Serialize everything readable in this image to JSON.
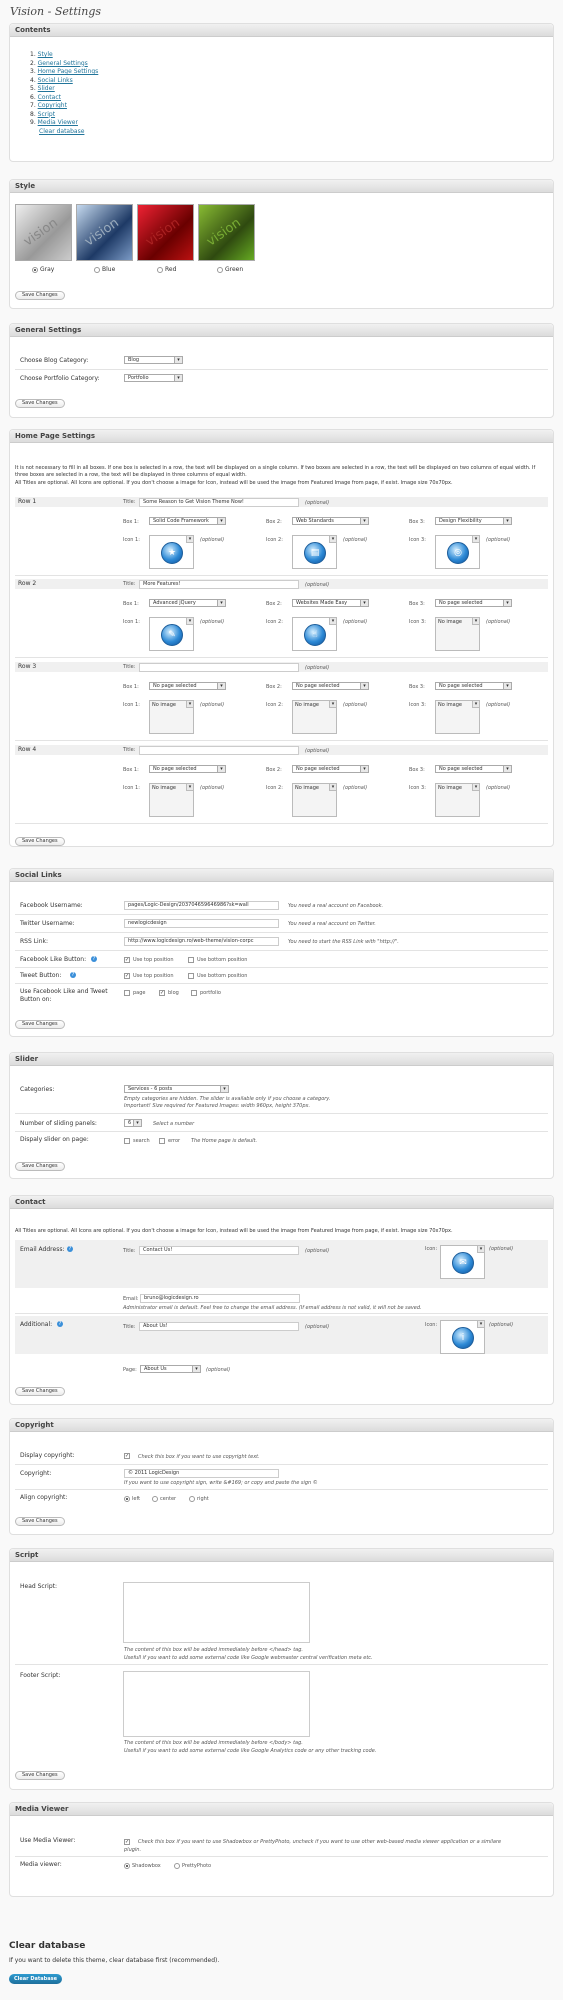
{
  "page_title": "Vision - Settings",
  "contents": {
    "heading": "Contents",
    "items": [
      "Style",
      "General Settings",
      "Home Page Settings",
      "Social Links",
      "Slider",
      "Contact",
      "Copyright",
      "Script",
      "Media Viewer"
    ],
    "clear_link": "Clear database"
  },
  "save_label": "Save Changes",
  "style": {
    "heading": "Style",
    "options": [
      {
        "label": "Gray",
        "selected": true
      },
      {
        "label": "Blue",
        "selected": false
      },
      {
        "label": "Red",
        "selected": false
      },
      {
        "label": "Green",
        "selected": false
      }
    ],
    "thumb_text": "vision"
  },
  "general": {
    "heading": "General Settings",
    "blog_label": "Choose Blog Category:",
    "blog_value": "Blog",
    "portfolio_label": "Choose Portfolio Category:",
    "portfolio_value": "Portfolio"
  },
  "home": {
    "heading": "Home Page Settings",
    "intro1": "It is not necessary to fill in all boxes. If one box is selected in a row, the text will be displayed on a single column. If two boxes are selected in a row, the text will be displayed on two columns of equal width. If three boxes are selected in a row, the text will be displayed in three columns of equal width.",
    "intro2": "All Titles are optional. All Icons are optional. If you don't choose a image for Icon, instead will be used the image from Featured Image from page, if exist. Image size 70x70px.",
    "title_label": "Title:",
    "optional": "(optional)",
    "box1": "Box 1:",
    "box2": "Box 2:",
    "box3": "Box 3:",
    "icon1": "Icon 1:",
    "icon2": "Icon 2:",
    "icon3": "Icon 3:",
    "no_image": "No image",
    "rows": [
      {
        "label": "Row 1",
        "title": "Some Reason to Get Vision Theme Now!",
        "boxes": [
          "Solid Code Framework",
          "Web Standards",
          "Design Flexibility"
        ],
        "icons": [
          true,
          true,
          true
        ]
      },
      {
        "label": "Row 2",
        "title": "More Features!",
        "boxes": [
          "Advanced jQuery",
          "Websites Made Easy",
          "No page selected"
        ],
        "icons": [
          true,
          true,
          false
        ]
      },
      {
        "label": "Row 3",
        "title": "",
        "boxes": [
          "No page selected",
          "No page selected",
          "No page selected"
        ],
        "icons": [
          false,
          false,
          false
        ]
      },
      {
        "label": "Row 4",
        "title": "",
        "boxes": [
          "No page selected",
          "No page selected",
          "No page selected"
        ],
        "icons": [
          false,
          false,
          false
        ]
      }
    ]
  },
  "social": {
    "heading": "Social Links",
    "fb_label": "Facebook Username:",
    "fb_value": "pages/Logic-Design/203704659646986?sk=wall",
    "fb_note": "You need a real account on Facebook.",
    "tw_label": "Twitter Username:",
    "tw_value": "newlogicdesign",
    "tw_note": "You need a real account on Twitter.",
    "rss_label": "RSS Link:",
    "rss_value": "http://www.logicdesign.ro/web-theme/vision-corpc",
    "rss_note": "You need to start the RSS Link with \"http://\".",
    "fblike_label": "Facebook Like Button:",
    "tweet_label": "Tweet Button:",
    "use_top": "Use top position",
    "use_bottom": "Use bottom position",
    "show_label1": "Use Facebook Like and Tweet",
    "show_label2": "Button on:",
    "page": "page",
    "blog": "blog",
    "portfolio": "portfolio"
  },
  "slider": {
    "heading": "Slider",
    "cat_label": "Categories:",
    "cat_value": "Services - 6 posts",
    "note1": "Empty categories are hidden. The slider is available only if you choose a category.",
    "note2": "Important! Size required for Featured Images: width 960px, height 370px.",
    "panels_label": "Number of sliding panels:",
    "panels_value": "6",
    "panels_note": "Select a number",
    "display_label": "Dispaly slider on page:",
    "search": "search",
    "error": "error",
    "display_note": "The Home page is default."
  },
  "contact": {
    "heading": "Contact",
    "intro": "All Titles are optional. All Icons are optional. If you don't choose a image for Icon, instead will be used the image from Featured Image from page, if exist. Image size 70x70px.",
    "email_label": "Email Address:",
    "title_label": "Title:",
    "title_value": "Contact Us!",
    "optional": "(optional)",
    "icon_label": "Icon:",
    "email_field_label": "Email:",
    "email_value": "bruno@logicdesign.ro",
    "email_note": "Administrator email is default. Feel free to change the email address. (If email address is not valid, it will not be saved.",
    "add_label": "Additional:",
    "add_title": "About Us!",
    "page_label": "Page:",
    "page_value": "About Us"
  },
  "copyright": {
    "heading": "Copyright",
    "display_label": "Display copyright:",
    "display_note": "Check this box if you want to use copyright text.",
    "copy_label": "Copyright:",
    "copy_value": "© 2011 LogicDesign",
    "copy_note": "If you want to use copyright sign, write &#169; or copy and paste the sign ©",
    "align_label": "Align copyright:",
    "left": "left",
    "center": "center",
    "right": "right"
  },
  "script": {
    "heading": "Script",
    "head_label": "Head Script:",
    "head_note1": "The content of this box will be added immediately before </head> tag.",
    "head_note2": "Usefull if you want to add some external code like Google webmaster central verification meta etc.",
    "foot_label": "Footer Script:",
    "foot_note1": "The content of this box will be added immediately before </body> tag.",
    "foot_note2": "Usefull if you want to add some external code like Google Analytics code or any other tracking code."
  },
  "media": {
    "heading": "Media Viewer",
    "use_label": "Use Media Viewer:",
    "use_note1": "Check this box if you want to use Shadowbox or PrettyPhoto, uncheck if you want to use other web-based media viewer application or a similare",
    "use_note2": "plugin.",
    "viewer_label": "Media viewer:",
    "shadowbox": "Shadowbox",
    "prettyphoto": "PrettyPhoto"
  },
  "clear": {
    "heading": "Clear database",
    "text": "If you want to delete this theme, clear database first (recommended).",
    "button": "Clear Database"
  },
  "colors": {
    "accent": "#21759b",
    "header": "#dcdcdc",
    "row_bg": "#f0f0f0"
  }
}
